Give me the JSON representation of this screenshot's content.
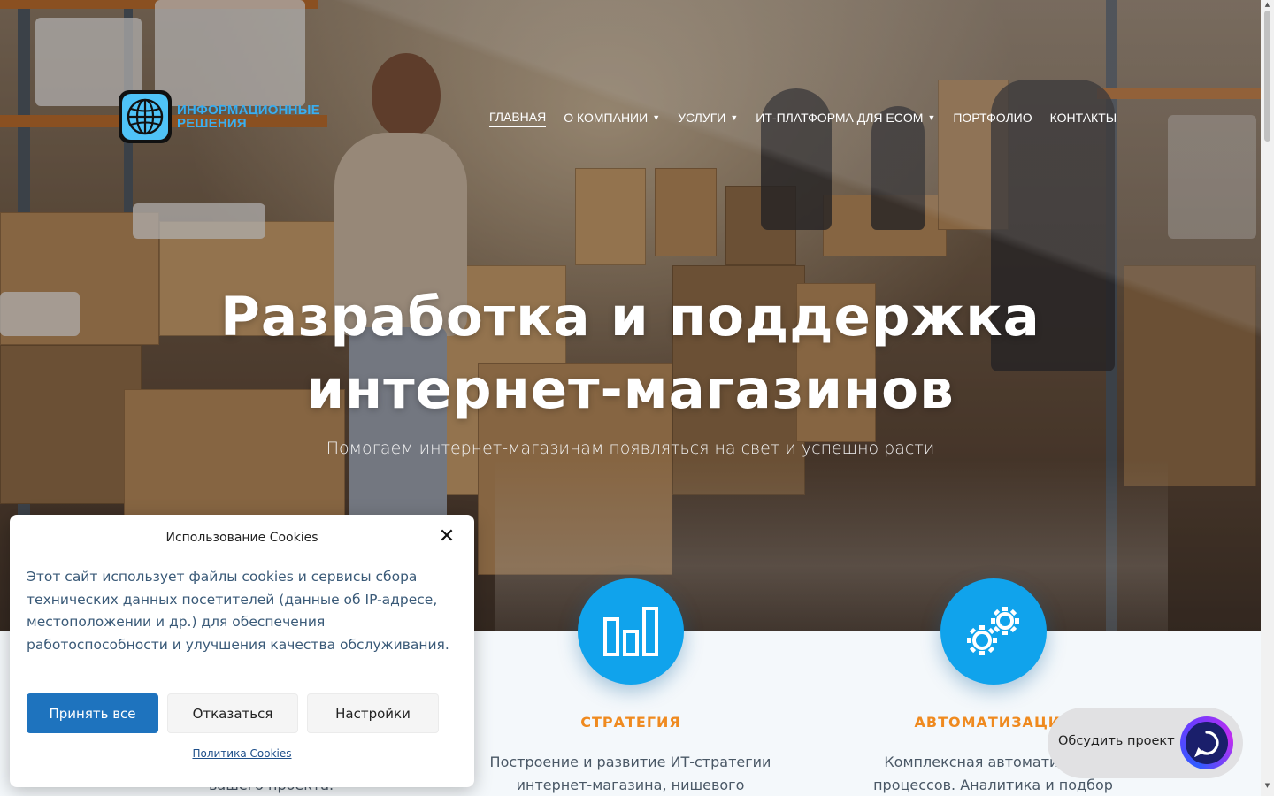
{
  "header": {
    "logo_line1": "ИНФОРМАЦИОННЫЕ",
    "logo_line2": "РЕШЕНИЯ",
    "logo_icon": "globe-icon",
    "nav": [
      {
        "label": "ГЛАВНАЯ",
        "active": true,
        "dropdown": false
      },
      {
        "label": "О КОМПАНИИ",
        "active": false,
        "dropdown": true
      },
      {
        "label": "УСЛУГИ",
        "active": false,
        "dropdown": true
      },
      {
        "label": "ИТ-ПЛАТФОРМА ДЛЯ ECOM",
        "active": false,
        "dropdown": true
      },
      {
        "label": "ПОРТФОЛИО",
        "active": false,
        "dropdown": false
      },
      {
        "label": "КОНТАКТЫ",
        "active": false,
        "dropdown": false
      }
    ]
  },
  "hero": {
    "title_line1": "Разработка и поддержка",
    "title_line2": "интернет-магазинов",
    "subtitle": "Помогаем интернет-магазинам появляться на свет и успешно расти"
  },
  "services": [
    {
      "icon": "bar-chart-icon",
      "title": "СТРАТЕГИЯ",
      "desc_line1": "Построение и развитие ИТ-стратегии",
      "desc_line2": "интернет-магазина, нишевого"
    },
    {
      "icon": "gears-icon",
      "title": "АВТОМАТИЗАЦИЯ",
      "desc_line1": "Комплексная автоматизация",
      "desc_line2": "процессов. Аналитика и подбор"
    }
  ],
  "hidden_text": "вашего проекта.",
  "cookie": {
    "title": "Использование Cookies",
    "text": "Этот сайт использует файлы cookies и сервисы сбора технических данных посетителей (данные об IP-адресе, местоположении и др.) для обеспечения работоспособности и улучшения качества обслуживания.",
    "accept": "Принять все",
    "decline": "Отказаться",
    "settings": "Настройки",
    "policy": "Политика Cookies"
  },
  "chat": {
    "label": "Обсудить проект",
    "icon": "chat-bubble-icon"
  },
  "colors": {
    "accent_blue": "#10a3ec",
    "title_orange": "#ef8a1f",
    "button_blue": "#1e73be",
    "logo_blue": "#39aef0"
  }
}
